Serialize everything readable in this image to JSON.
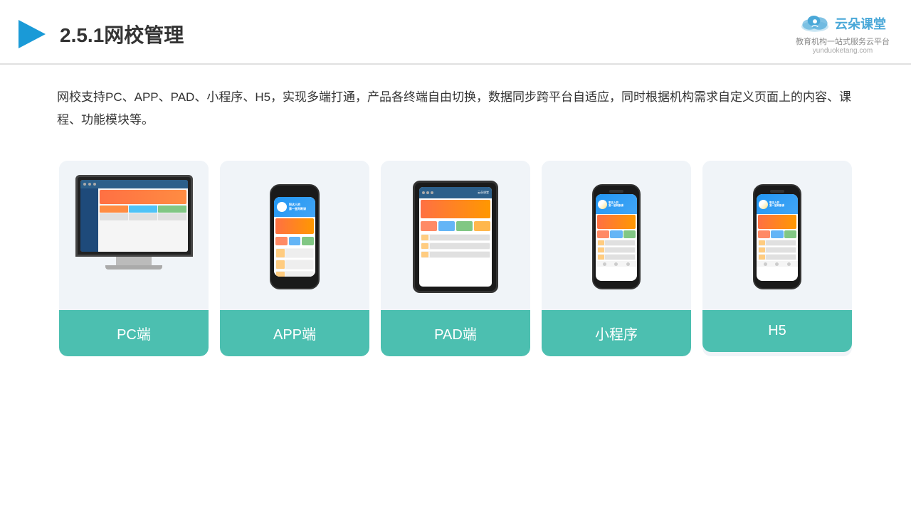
{
  "header": {
    "title": "2.5.1网校管理",
    "logo": {
      "name": "云朵课堂",
      "url": "yunduoketang.com",
      "tagline": "教育机构一站式服务云平台"
    }
  },
  "description": "网校支持PC、APP、PAD、小程序、H5，实现多端打通，产品各终端自由切换，数据同步跨平台自适应，同时根据机构需求自定义页面上的内容、课程、功能模块等。",
  "cards": [
    {
      "id": "pc",
      "label": "PC端"
    },
    {
      "id": "app",
      "label": "APP端"
    },
    {
      "id": "pad",
      "label": "PAD端"
    },
    {
      "id": "mini",
      "label": "小程序"
    },
    {
      "id": "h5",
      "label": "H5"
    }
  ]
}
